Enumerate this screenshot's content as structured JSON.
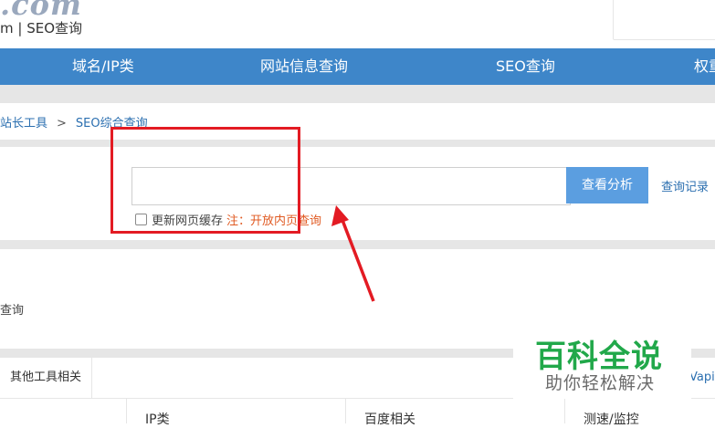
{
  "header": {
    "logo_com": ".com",
    "logo_sub": "m | SEO查询"
  },
  "nav": {
    "items": [
      "域名/IP类",
      "网站信息查询",
      "SEO查询",
      "权重"
    ]
  },
  "breadcrumb": {
    "parent": "站长工具",
    "separator": ">",
    "current": "SEO综合查询"
  },
  "search": {
    "input_value": "",
    "button_label": "查看分析",
    "history_link": "查询记录"
  },
  "cache": {
    "label": "更新网页缓存",
    "note": "注：开放内页查询",
    "checked": false
  },
  "side": {
    "label": "查询"
  },
  "tabs": {
    "other": "其他工具相关",
    "right_partial": "Vapi"
  },
  "categories": [
    "IP类",
    "百度相关",
    "测速/监控"
  ],
  "watermark": {
    "title": "百科全说",
    "subtitle": "助你轻松解决"
  },
  "colors": {
    "nav": "#3e86c9",
    "button": "#5b9ee0",
    "note": "#e05a22",
    "annotation": "#e31b23",
    "watermark": "#21a84a"
  }
}
